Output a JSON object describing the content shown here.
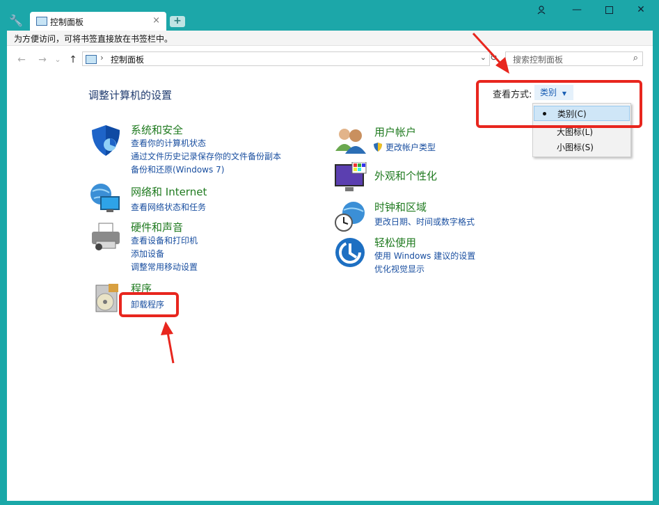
{
  "tab": {
    "title": "控制面板"
  },
  "bookmark_bar": {
    "text": "为方便访问，可将书签直接放在书签栏中。"
  },
  "address": {
    "location": "控制面板",
    "search_placeholder": "搜索控制面板"
  },
  "page": {
    "heading": "调整计算机的设置"
  },
  "view": {
    "label": "查看方式:",
    "selected": "类别",
    "options": [
      "类别(C)",
      "大图标(L)",
      "小图标(S)"
    ]
  },
  "categories_left": [
    {
      "title": "系统和安全",
      "links": [
        "查看你的计算机状态",
        "通过文件历史记录保存你的文件备份副本",
        "备份和还原(Windows 7)"
      ]
    },
    {
      "title": "网络和 Internet",
      "links": [
        "查看网络状态和任务"
      ]
    },
    {
      "title": "硬件和声音",
      "links": [
        "查看设备和打印机",
        "添加设备",
        "调整常用移动设置"
      ]
    },
    {
      "title": "程序",
      "links": [
        "卸载程序"
      ]
    }
  ],
  "categories_right": [
    {
      "title": "用户帐户",
      "links": [
        "更改帐户类型"
      ]
    },
    {
      "title": "外观和个性化",
      "links": []
    },
    {
      "title": "时钟和区域",
      "links": [
        "更改日期、时间或数字格式"
      ]
    },
    {
      "title": "轻松使用",
      "links": [
        "使用 Windows 建议的设置",
        "优化视觉显示"
      ]
    }
  ],
  "colors": {
    "titlebar": "#1ca7a9",
    "category_title": "#1f7a1f",
    "link": "#1a4fa0",
    "annotation_red": "#e8261e"
  }
}
